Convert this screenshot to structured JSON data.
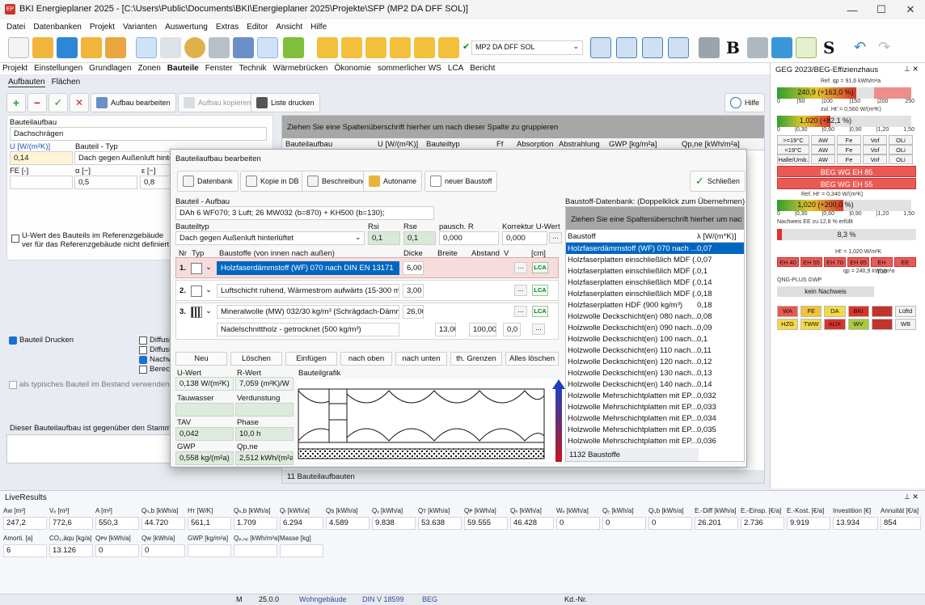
{
  "window": {
    "title": "BKI Energieplaner 2025 - [C:\\Users\\Public\\Documents\\BKI\\Energieplaner 2025\\Projekte\\SFP (MP2 DA DFF SOL)]",
    "controls": [
      "—",
      "☐",
      "✕"
    ]
  },
  "menu": [
    "Datei",
    "Datenbanken",
    "Projekt",
    "Varianten",
    "Auswertung",
    "Extras",
    "Editor",
    "Ansicht",
    "Hilfe"
  ],
  "toolbar": {
    "project": "MP2 DA DFF SOL",
    "letter_b": "B",
    "letter_s": "S"
  },
  "tabs": [
    "Projekt",
    "Einstellungen",
    "Grundlagen",
    "Zonen",
    "Bauteile",
    "Fenster",
    "Technik",
    "Wärmebrücken",
    "Ökonomie",
    "sommerlicher WS",
    "LCA",
    "Bericht"
  ],
  "subtabs": [
    "Aufbauten",
    "Flächen"
  ],
  "actions": {
    "edit": "Aufbau bearbeiten",
    "copy": "Aufbau kopieren",
    "print": "Liste drucken",
    "help": "Hilfe"
  },
  "left": {
    "bauteilaufbau_label": "Bauteilaufbau",
    "bauteilaufbau_value": "Dachschrägen",
    "u_label": "U [W/(m²K)]",
    "u_value": "0,14",
    "typ_label": "Bauteil - Typ",
    "typ_value": "Dach gegen Außenluft hinterl",
    "fe_label": "FE [-]",
    "alpha_label": "α [−]",
    "eps_label": "ε [−]",
    "alpha_value": "0,5",
    "eps_value": "0,8",
    "ref_text": "U-Wert des Bauteils im Referenzgebäude ver für das Referenzgebäude nicht definiert wird",
    "drucken": "Bauteil Drucken",
    "diffusi1": "Diffusi",
    "diffusi2": "Diffusi",
    "nachw": "Nachw",
    "berech": "Berech",
    "typisch": "als typisches Bauteil im Bestand verwenden",
    "vergleich": "Dieser Bauteilaufbau ist gegenüber den Stamm"
  },
  "grid": {
    "group_hint": "Ziehen Sie eine Spaltenüberschrift hierher um nach dieser Spalte zu gruppieren",
    "headers": [
      "Bauteilaufbau",
      "U [W/(m²K)]",
      "Bauteiltyp",
      "Ff",
      "Absorption",
      "Abstrahlung",
      "GWP [kg/m²a]",
      "Qp,ne [kWh/m²a]"
    ],
    "footer": "11 Bauteilaufbauten"
  },
  "dialog": {
    "title": "Bauteilaufbau bearbeiten",
    "buttons": [
      "Datenbank",
      "Kopie in DB",
      "Beschreibung",
      "Autoname",
      "neuer Baustoff"
    ],
    "close": "Schließen",
    "aufbau_label": "Bauteil - Aufbau",
    "aufbau_value": "DAh 6 WF070; 3 Luft; 26 MW032 (b=870) + KH500 (b=130);",
    "typ_label": "Bauteiltyp",
    "typ_value": "Dach gegen Außenluft hinterlüftet",
    "rsi_label": "Rsi",
    "rsi": "0,1",
    "rse_label": "Rse",
    "rse": "0,1",
    "pausch_label": "pausch. R",
    "pausch": "0,000",
    "korr_label": "Korrektur U-Wert",
    "korr": "0,000",
    "cols": [
      "Nr",
      "Typ",
      "Baustoffe (von innen nach außen)",
      "Dicke",
      "Breite",
      "Abstand",
      "V",
      "[cm]"
    ],
    "layers": [
      {
        "nr": "1.",
        "name": "Holzfaserdämmstoff (WF) 070 nach DIN EN 13171",
        "dicke": "6,00"
      },
      {
        "nr": "2.",
        "name": "Luftschicht ruhend, Wärmestrom aufwärts (15-300 m",
        "dicke": "3,00"
      },
      {
        "nr": "3.",
        "name": "Mineralwolle (MW) 032/30 kg/m³ (Schrägdach-Dämm",
        "dicke": "26,00",
        "sub": "Nadelschnittholz - getrocknet (500 kg/m³)",
        "breite": "13,00",
        "abstand": "100,00",
        "v": "0,0"
      }
    ],
    "lca": "LCA",
    "dots": "...",
    "bottom_buttons": [
      "Neu",
      "Löschen",
      "Einfügen",
      "nach oben",
      "nach unten",
      "th. Grenzen",
      "Alles löschen"
    ],
    "uwert_label": "U-Wert",
    "uwert": "0,138 W/(m²K)",
    "rwert_label": "R-Wert",
    "rwert": "7,059 (m²K)/W",
    "tau_label": "Tauwasser",
    "verd_label": "Verdunstung",
    "tav_label": "TAV",
    "tav": "0,042",
    "phase_label": "Phase",
    "phase": "10,0 h",
    "gwp_label": "GWP",
    "gwp": "0,558 kg/(m²a)",
    "qp_label": "Qp,ne",
    "qp": "2,512 kWh/(m²a)",
    "grafik_label": "Bauteilgrafik",
    "db_title": "Baustoff-Datenbank: (Doppelklick zum Übernehmen)",
    "db_hint": "Ziehen Sie eine Spaltenüberschrift hierher um nach",
    "db_headers": [
      "Baustoff",
      "λ [W/(m*K)]"
    ],
    "db_rows": [
      [
        "Holzfaserdämmstoff (WF) 070 nach ...",
        "0,07"
      ],
      [
        "Holzfaserplatten einschließlich MDF (...",
        "0,07"
      ],
      [
        "Holzfaserplatten einschließlich MDF (...",
        "0,1"
      ],
      [
        "Holzfaserplatten einschließlich MDF (...",
        "0,14"
      ],
      [
        "Holzfaserplatten einschließlich MDF (...",
        "0,18"
      ],
      [
        "Holzfaserplatten HDF (900 kg/m³)",
        "0,18"
      ],
      [
        "Holzwolle Deckschicht(en) 080 nach...",
        "0,08"
      ],
      [
        "Holzwolle Deckschicht(en) 090 nach...",
        "0,09"
      ],
      [
        "Holzwolle Deckschicht(en) 100 nach...",
        "0,1"
      ],
      [
        "Holzwolle Deckschicht(en) 110 nach...",
        "0,11"
      ],
      [
        "Holzwolle Deckschicht(en) 120 nach...",
        "0,12"
      ],
      [
        "Holzwolle Deckschicht(en) 130 nach...",
        "0,13"
      ],
      [
        "Holzwolle Deckschicht(en) 140 nach...",
        "0,14"
      ],
      [
        "Holzwolle Mehrschichtplatten mit EP...",
        "0,032"
      ],
      [
        "Holzwolle Mehrschichtplatten mit EP...",
        "0,033"
      ],
      [
        "Holzwolle Mehrschichtplatten mit EP...",
        "0,034"
      ],
      [
        "Holzwolle Mehrschichtplatten mit EP...",
        "0,035"
      ],
      [
        "Holzwolle Mehrschichtplatten mit EP...",
        "0,036"
      ]
    ],
    "db_footer": "1132 Baustoffe"
  },
  "right": {
    "title": "GEG 2023/BEG-Effizienzhaus",
    "ref_qp": "Ref. qp = 91,6 kWh/m²a",
    "bar1": "240,9 (+163,0 %)",
    "bar1_fill": 0.82,
    "scale1": [
      "0",
      "|50",
      "|100",
      "|150",
      "|200",
      "250"
    ],
    "zul": "zul. Ht' = 0,560 W/(m²K)",
    "bar2": "1,020 (+82,1 %)",
    "bar2_fill": 0.55,
    "scale2": [
      "0",
      "|0,30",
      "|0,60",
      "|0,90",
      "|1,20",
      "1,50"
    ],
    "klima_rows": [
      [
        ">=19°C",
        "AW",
        "Fe",
        "Vof",
        "OLi"
      ],
      [
        "<19°C",
        "AW",
        "Fe",
        "Vof",
        "OLi"
      ],
      [
        "Halle/Umb.",
        "AW",
        "Fe",
        "Vof",
        "OLi"
      ]
    ],
    "beg1": "BEG WG EH 85",
    "beg2": "BEG WG EH 55",
    "ref_ht": "Ref. Ht' = 0,340 W/(m²K)",
    "bar3": "1,020 (+200,0 %)",
    "bar3_fill": 0.68,
    "scale3": [
      "0",
      "|0,30",
      "|0,60",
      "|0,90",
      "|1,20",
      "1,50"
    ],
    "ee_text": "Nachweis EE zu 12,8 % erfüllt",
    "ee_value": "8,3 %",
    "eh_cells": [
      "EH 40",
      "EH 55",
      "EH 70",
      "EH 85",
      "EH 100",
      "EE"
    ],
    "ht_text": "Ht' = 1,020 W/m²K",
    "qp_text": "qp = 240,9 kWh/m²a",
    "qng": "QNG-PLUS GWP",
    "kein": "kein Nachweis",
    "row1": [
      "WA",
      "FE",
      "DA",
      "BKI",
      "",
      "Lüftd"
    ],
    "row2": [
      "HZG",
      "TWW",
      "AUX",
      "WV",
      "",
      "WB"
    ]
  },
  "live": {
    "title": "LiveResults",
    "row1": [
      [
        "Aᴡ [m²]",
        "247,2"
      ],
      [
        "Vₑ [m³]",
        "772,6"
      ],
      [
        "A [m²]",
        "550,3"
      ],
      [
        "Qₕ,b [kWh/a]",
        "44.720"
      ],
      [
        "Hт [W/K]",
        "561,1"
      ],
      [
        "Qₕ,b [kWh/a]",
        "1.709"
      ],
      [
        "Qₗ [kWh/a]",
        "6.294"
      ],
      [
        "Qs [kWh/a]",
        "4.589"
      ],
      [
        "Qᵥ [kWh/a]",
        "9.838"
      ],
      [
        "Qт [kWh/a]",
        "53.638"
      ],
      [
        "Qᴘ [kWh/a]",
        "59.555"
      ],
      [
        "Qₕ [kWh/a]",
        "46.428"
      ],
      [
        "Wₑ [kWh/a]",
        "0"
      ],
      [
        "Qₑ [kWh/a]",
        "0"
      ],
      [
        "Qₗ,b [kWh/a]",
        "0"
      ],
      [
        "E.-Diff [kWh/a]",
        "26.201"
      ],
      [
        "E.-Einsp. [€/a]",
        "2.736"
      ],
      [
        "E.-Kost. [€/a]",
        "9.919"
      ],
      [
        "Investition [€]",
        "13.934"
      ],
      [
        "Annuität [€/a]",
        "854"
      ]
    ],
    "row2": [
      [
        "Amorti. [a]",
        "6"
      ],
      [
        "CO₂,äqu [kg/a]",
        "13.126"
      ],
      [
        "Qᴘᴠ [kWh/a]",
        "0"
      ],
      [
        "Qᴡ [kWh/a]",
        "0"
      ],
      [
        "GWP [kg/m²a]",
        ""
      ],
      [
        "Qₚ,ₙₑ [kWh/m²a]",
        ""
      ],
      [
        "Masse [kg]",
        ""
      ]
    ]
  },
  "status": {
    "m": "M",
    "version": "25.0.0",
    "gebaeude": "Wohngebäude",
    "din": "DIN V 18599",
    "beg": "BEG",
    "kd": "Kd.-Nr."
  }
}
